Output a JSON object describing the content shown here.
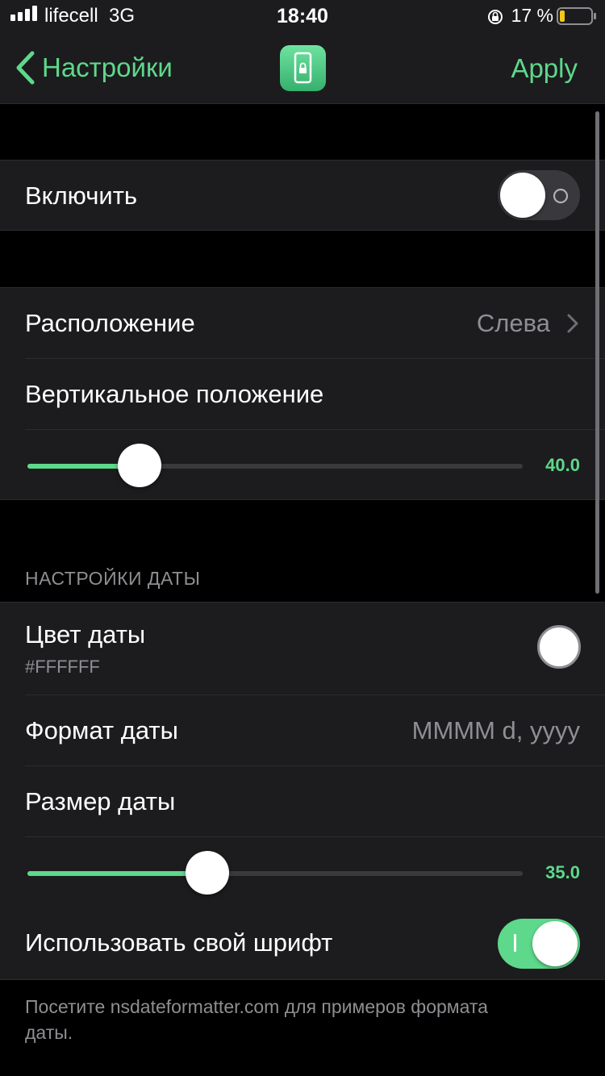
{
  "status_bar": {
    "carrier": "lifecell",
    "network": "3G",
    "time": "18:40",
    "battery_text": "17 %",
    "battery_level": 0.17
  },
  "nav": {
    "back_label": "Настройки",
    "apply_label": "Apply",
    "app_icon": "phone-lock-icon"
  },
  "enable": {
    "label": "Включить",
    "on": false
  },
  "position": {
    "label": "Расположение",
    "value": "Слева",
    "vertical_label": "Вертикальное положение",
    "vertical_value": 40.0,
    "vertical_value_text": "40.0",
    "vertical_max": 100
  },
  "date_settings": {
    "header": "НАСТРОЙКИ ДАТЫ",
    "color_label": "Цвет даты",
    "color_value": "#FFFFFF",
    "format_label": "Формат даты",
    "format_value": "MMMM d, yyyy",
    "size_label": "Размер даты",
    "size_value": 35.0,
    "size_value_text": "35.0",
    "size_max": 100,
    "custom_font_label": "Использовать свой шрифт",
    "custom_font_on": true,
    "footer": "Посетите nsdateformatter.com для примеров формата даты."
  },
  "colors": {
    "accent": "#5ed88b",
    "background": "#000000",
    "cell": "#1c1c1e"
  }
}
